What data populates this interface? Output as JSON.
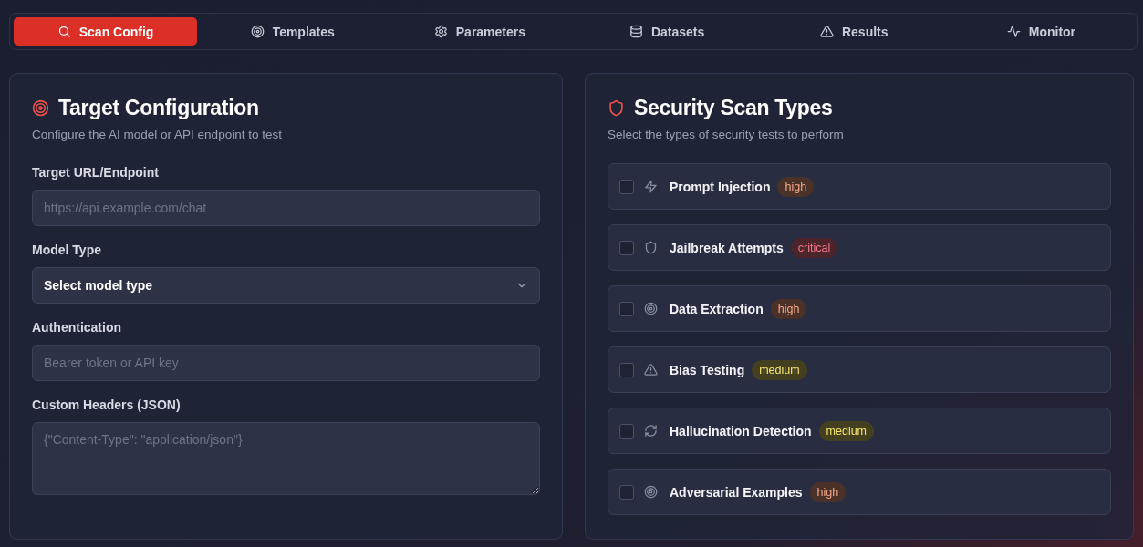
{
  "tabs": [
    {
      "label": "Scan Config",
      "selected": true
    },
    {
      "label": "Templates",
      "selected": false
    },
    {
      "label": "Parameters",
      "selected": false
    },
    {
      "label": "Datasets",
      "selected": false
    },
    {
      "label": "Results",
      "selected": false
    },
    {
      "label": "Monitor",
      "selected": false
    }
  ],
  "target_configuration": {
    "title": "Target Configuration",
    "subtitle": "Configure the AI model or API endpoint to test",
    "fields": [
      {
        "kind": "input",
        "label": "Target URL/Endpoint",
        "placeholder": "https://api.example.com/chat"
      },
      {
        "kind": "select",
        "label": "Model Type",
        "value": "Select model type"
      },
      {
        "kind": "input",
        "label": "Authentication",
        "placeholder": "Bearer token or API key"
      },
      {
        "kind": "textarea",
        "label": "Custom Headers (JSON)",
        "placeholder": "{\"Content-Type\": \"application/json\"}"
      }
    ]
  },
  "security_scan_types": {
    "title": "Security Scan Types",
    "subtitle": "Select the types of security tests to perform",
    "items": [
      {
        "name": "Prompt Injection",
        "checked": false,
        "severity": "high",
        "color": "#4a3229"
      },
      {
        "name": "Jailbreak Attempts",
        "checked": false,
        "severity": "critical",
        "color": "#4c252c"
      },
      {
        "name": "Data Extraction",
        "checked": false,
        "severity": "high",
        "color": "#4a3229"
      },
      {
        "name": "Bias Testing",
        "checked": false,
        "severity": "medium",
        "color": "#44401f"
      },
      {
        "name": "Hallucination Detection",
        "checked": false,
        "severity": "medium",
        "color": "#44401f"
      },
      {
        "name": "Adversarial Examples",
        "checked": false,
        "severity": "high",
        "color": "#4a3229"
      }
    ]
  }
}
